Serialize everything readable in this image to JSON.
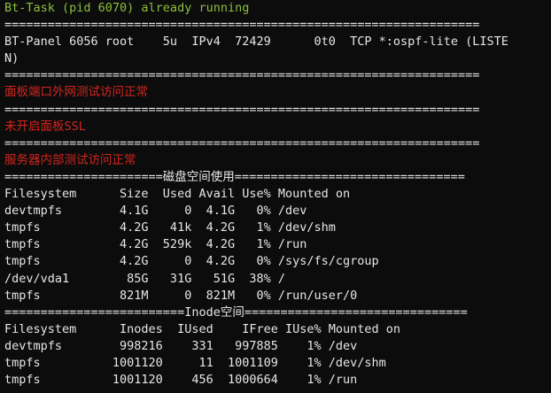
{
  "colors": {
    "background": "#0c0c0c",
    "default_text": "#e6e6e6",
    "status_green": "#8cbf3c",
    "alert_red": "#d2251f"
  },
  "lines": [
    {
      "text": "Bt-Task (pid 6070) already running",
      "color": "green"
    },
    {
      "text": "==================================================================",
      "color": "white"
    },
    {
      "text": "BT-Panel 6056 root    5u  IPv4  72429      0t0  TCP *:ospf-lite (LISTE",
      "color": "white"
    },
    {
      "text": "N)",
      "color": "white"
    },
    {
      "text": "==================================================================",
      "color": "white"
    },
    {
      "text": "面板端口外网测试访问正常",
      "color": "red"
    },
    {
      "text": "==================================================================",
      "color": "white"
    },
    {
      "text": "未开启面板SSL",
      "color": "red"
    },
    {
      "text": "==================================================================",
      "color": "white"
    },
    {
      "text": "服务器内部测试访问正常",
      "color": "red"
    },
    {
      "text": "======================磁盘空间使用================================",
      "color": "white"
    },
    {
      "text": "Filesystem      Size  Used Avail Use% Mounted on",
      "color": "white"
    },
    {
      "text": "devtmpfs        4.1G     0  4.1G   0% /dev",
      "color": "white"
    },
    {
      "text": "tmpfs           4.2G   41k  4.2G   1% /dev/shm",
      "color": "white"
    },
    {
      "text": "tmpfs           4.2G  529k  4.2G   1% /run",
      "color": "white"
    },
    {
      "text": "tmpfs           4.2G     0  4.2G   0% /sys/fs/cgroup",
      "color": "white"
    },
    {
      "text": "/dev/vda1        85G   31G   51G  38% /",
      "color": "white"
    },
    {
      "text": "tmpfs           821M     0  821M   0% /run/user/0",
      "color": "white"
    },
    {
      "text": "=========================Inode空间===============================",
      "color": "white"
    },
    {
      "text": "Filesystem      Inodes  IUsed    IFree IUse% Mounted on",
      "color": "white"
    },
    {
      "text": "devtmpfs        998216    331   997885    1% /dev",
      "color": "white"
    },
    {
      "text": "tmpfs          1001120     11  1001109    1% /dev/shm",
      "color": "white"
    },
    {
      "text": "tmpfs          1001120    456  1000664    1% /run",
      "color": "white"
    }
  ]
}
